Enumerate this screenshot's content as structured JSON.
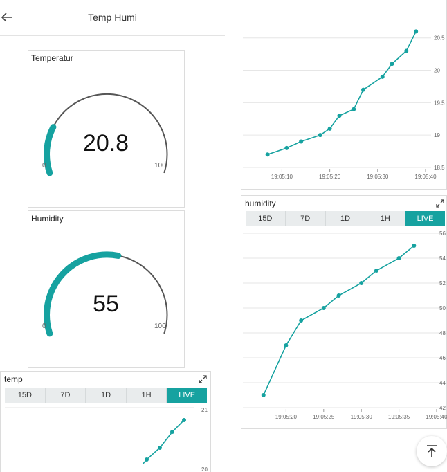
{
  "header": {
    "title": "Temp Humi",
    "back_icon": "arrow-left-icon"
  },
  "colors": {
    "accent": "#16a2a0",
    "arc_track": "#555555",
    "grid": "#e6e6e6"
  },
  "temperature_widget": {
    "title": "Temperatur",
    "value": "20.8",
    "min": "0",
    "max": "100",
    "fraction": 0.208
  },
  "humidity_widget": {
    "title": "Humidity",
    "value": "55",
    "min": "0",
    "max": "100",
    "fraction": 0.55
  },
  "temp_chart_widget": {
    "title": "temp",
    "ranges": [
      "15D",
      "7D",
      "1D",
      "1H",
      "LIVE"
    ],
    "active_range": "LIVE",
    "y_ticks": [
      "21",
      "20"
    ]
  },
  "humidity_chart_widget": {
    "title": "humidity",
    "ranges": [
      "15D",
      "7D",
      "1D",
      "1H",
      "LIVE"
    ],
    "active_range": "LIVE"
  },
  "chart_data": [
    {
      "type": "line",
      "series": [
        {
          "values": [
            18.7,
            18.8,
            18.9,
            19.0,
            19.1,
            19.3,
            19.4,
            19.7,
            19.9,
            20.1,
            20.3,
            20.6
          ]
        }
      ],
      "x": [
        "19:05:07",
        "19:05:11",
        "19:05:14",
        "19:05:18",
        "19:05:20",
        "19:05:22",
        "19:05:25",
        "19:05:27",
        "19:05:31",
        "19:05:33",
        "19:05:36",
        "19:05:38"
      ],
      "x_ticks": [
        "19:05:10",
        "19:05:20",
        "19:05:30",
        "19:05:40"
      ],
      "y_ticks": [
        "20.5",
        "20",
        "19.5",
        "19",
        "18.5"
      ],
      "ylim": [
        18.5,
        20.7
      ]
    },
    {
      "type": "line",
      "series": [
        {
          "values": [
            43,
            47,
            49,
            50,
            51,
            52,
            53,
            54,
            55
          ]
        }
      ],
      "x": [
        "19:05:17",
        "19:05:20",
        "19:05:22",
        "19:05:25",
        "19:05:27",
        "19:05:30",
        "19:05:32",
        "19:05:35",
        "19:05:37"
      ],
      "x_ticks": [
        "19:05:20",
        "19:05:25",
        "19:05:30",
        "19:05:35",
        "19:05:40"
      ],
      "y_ticks": [
        "56",
        "54",
        "52",
        "50",
        "48",
        "46",
        "44",
        "42"
      ],
      "ylim": [
        42,
        56
      ]
    }
  ]
}
